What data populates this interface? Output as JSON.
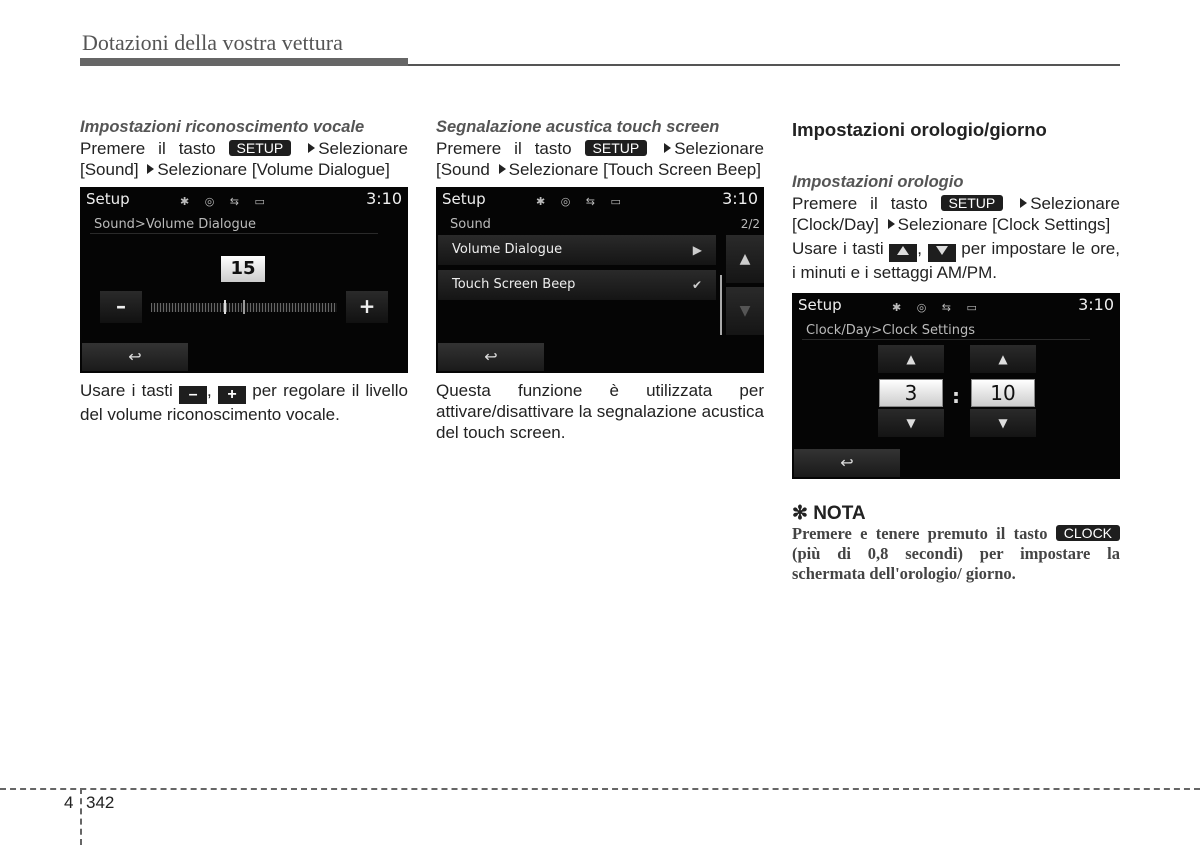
{
  "header": {
    "title": "Dotazioni della vostra vettura"
  },
  "screen_common": {
    "title": "Setup",
    "time": "3:10",
    "icons": "✱ ◎ ⇆ ▭",
    "back_icon": "↩"
  },
  "col1": {
    "subhead": "Impostazioni riconoscimento vocale",
    "p1_a": "Premere il tasto",
    "key": "SETUP",
    "p1_b": "Selezionare [Sound]",
    "p1_c": "Selezionare [Volume Dialogue]",
    "screen": {
      "breadcrumb": "Sound>Volume Dialogue",
      "value": "15",
      "minus": "–",
      "plus": "+",
      "level_fraction": 0.39
    },
    "p2_a": "Usare i tasti",
    "minus_key": "–",
    "plus_key": "+",
    "p2_b": "per regolare il livello del volume riconoscimento vocale."
  },
  "col2": {
    "subhead": "Segnalazione acustica touch screen",
    "p1_a": "Premere il tasto",
    "key": "SETUP",
    "p1_b": "Selezionare [Sound",
    "p1_c": "Selezionare [Touch Screen Beep]",
    "screen": {
      "breadcrumb": "Sound",
      "page": "2/2",
      "items": [
        {
          "label": "Volume Dialogue",
          "right": "▶"
        },
        {
          "label": "Touch Screen Beep",
          "right": "✔"
        }
      ],
      "up": "▲",
      "down": "▼"
    },
    "p2": "Questa funzione è utilizzata per attivare/disattivare la segnalazione acustica del touch screen."
  },
  "col3": {
    "head": "Impostazioni orologio/giorno",
    "subhead": "Impostazioni orologio",
    "p1_a": "Premere il tasto",
    "key": "SETUP",
    "p1_b": "Selezionare [Clock/Day]",
    "p1_c": "Selezionare [Clock Settings]",
    "p2_a": "Usare i tasti",
    "p2_b": "per impostare le ore, i minuti e i settaggi AM/PM.",
    "screen": {
      "breadcrumb": "Clock/Day>Clock Settings",
      "hour": "3",
      "minute": "10",
      "colon": ":",
      "up": "▲",
      "down": "▼"
    },
    "nota": {
      "title": "✻ NOTA",
      "p_a": "Premere e tenere premuto il tasto",
      "key": "CLOCK",
      "p_b": "(più di 0,8 secondi) per impostare la schermata dell'orologio/ giorno."
    }
  },
  "footer": {
    "chapter": "4",
    "page": "342"
  }
}
